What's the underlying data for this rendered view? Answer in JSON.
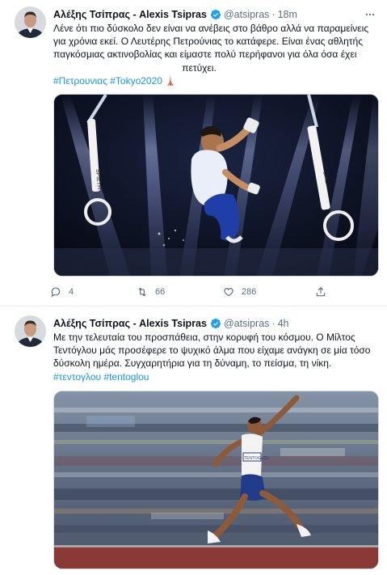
{
  "tweets": [
    {
      "author_name": "Αλέξης Τσίπρας - Alexis Tsipras",
      "handle": "@atsipras",
      "separator": "·",
      "time": "18m",
      "text_lines": [
        "Λένε ότι πιο δύσκολο δεν είναι να ανέβεις στο βάθρο αλλά να παραμείνεις",
        "για χρόνια εκεί. Ο Λευτέρης Πετρούνιας το κατάφερε. Είναι ένας αθλητής",
        "παγκόσμιας ακτινοβολίας και είμαστε πολύ περήφανοι για όλα όσα έχει",
        "πετύχει."
      ],
      "hashtags": [
        "#Πετρουνιας",
        "#Tokyo2020"
      ],
      "emoji": "🗼",
      "stats": {
        "replies": "4",
        "retweets": "66",
        "likes": "286"
      },
      "media": {
        "ring_label": "SPIETH",
        "description": "gymnast on rings"
      }
    },
    {
      "author_name": "Αλέξης Τσίπρας - Alexis Tsipras",
      "handle": "@atsipras",
      "separator": "·",
      "time": "4h",
      "text_lines": [
        "Με την τελευταία του προσπάθεια, στην κορυφή του κόσμου. Ο Μίλτος",
        "Τεντόγλου μάς προσέφερε το ψυχικό άλμα που είχαμε ανάγκη σε μία τόσο",
        "δύσκολη ημέρα. Συγχαρητήρια για τη δύναμη, το πείσμα, τη νίκη."
      ],
      "hashtags": [
        "#τεντογλου",
        "#tentoglou"
      ],
      "bib_label": "TENTOGLOU"
    }
  ],
  "colors": {
    "link": "#1b95e0",
    "verified": "#1da1f2",
    "muted": "#5b7083",
    "text": "#0f1419"
  }
}
